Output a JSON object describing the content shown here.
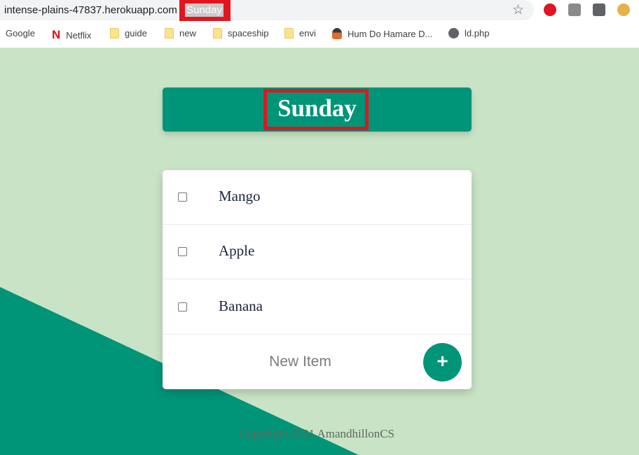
{
  "browser": {
    "url": "intense-plains-47837.herokuapp.com",
    "tab_title": "Sunday"
  },
  "bookmarks": [
    {
      "label": "Google",
      "icon": "google-icon"
    },
    {
      "label": "Netflix",
      "icon": "netflix-icon"
    },
    {
      "label": "guide",
      "icon": "folder-icon"
    },
    {
      "label": "new",
      "icon": "folder-icon"
    },
    {
      "label": "spaceship",
      "icon": "folder-icon"
    },
    {
      "label": "envi",
      "icon": "folder-icon"
    },
    {
      "label": "Hum Do Hamare D...",
      "icon": "site-icon"
    },
    {
      "label": "ld.php",
      "icon": "globe-icon"
    }
  ],
  "page": {
    "title": "Sunday",
    "items": [
      {
        "label": "Mango",
        "checked": false
      },
      {
        "label": "Apple",
        "checked": false
      },
      {
        "label": "Banana",
        "checked": false
      }
    ],
    "new_item_placeholder": "New Item",
    "add_button_label": "+",
    "footer": "Copyright 2021 AmandhillonCS"
  },
  "colors": {
    "background": "#c8e3c5",
    "accent": "#009479",
    "highlight": "#e0151f"
  }
}
